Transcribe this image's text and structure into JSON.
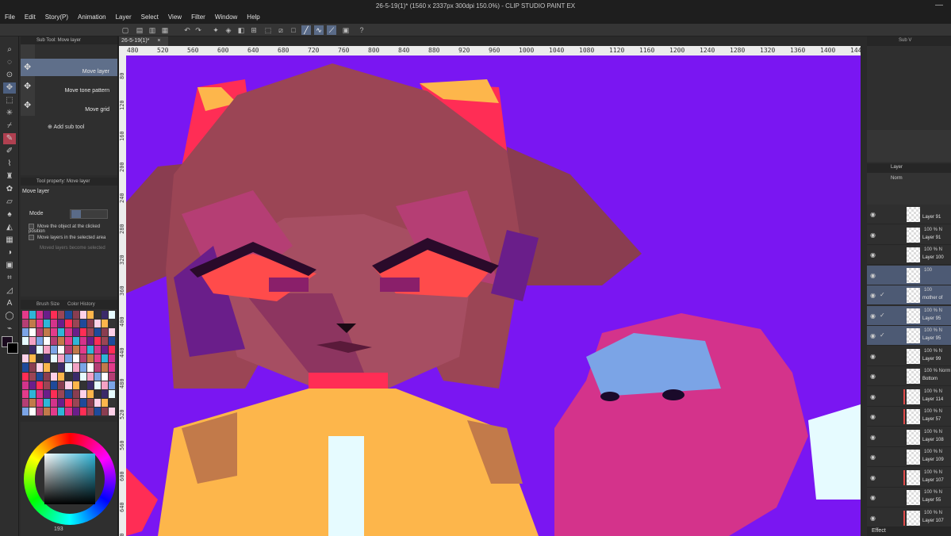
{
  "window": {
    "title": "26-5-19(1)* (1560 x 2337px 300dpi 150.0%)  - CLIP STUDIO PAINT EX",
    "minimize": "—"
  },
  "menu": [
    "File",
    "Edit",
    "Story(P)",
    "Animation",
    "Layer",
    "Select",
    "View",
    "Filter",
    "Window",
    "Help"
  ],
  "subtool": {
    "title": "Sub Tool: Move layer",
    "items": [
      "Move layer",
      "Move tone pattern",
      "Move grid"
    ],
    "add_label": "Add sub tool"
  },
  "tool_property": {
    "title": "Tool property: Move layer",
    "heading": "Move layer",
    "mode_label": "Mode",
    "options": [
      "Move the object at the clicked position",
      "Move layers in the selected area",
      "Moved layers become selected"
    ]
  },
  "color_tabs": [
    "Brush Size",
    "Color History"
  ],
  "color_wheel": {
    "value_label": "193"
  },
  "document": {
    "tab_label": "26-5-19(1)*",
    "ruler_h": [
      "480",
      "520",
      "560",
      "600",
      "640",
      "680",
      "720",
      "760",
      "800",
      "840",
      "880",
      "920",
      "960",
      "1000",
      "1040",
      "1080",
      "1120",
      "1160",
      "1200",
      "1240",
      "1280",
      "1320",
      "1360",
      "1400",
      "1440"
    ],
    "ruler_v": [
      "80",
      "120",
      "160",
      "200",
      "240",
      "280",
      "320",
      "360",
      "400",
      "440",
      "480",
      "520",
      "560",
      "600",
      "640",
      "680"
    ]
  },
  "right_panel": {
    "tab": "Sub V",
    "layer_tab": "Layer",
    "blend": "Norm",
    "effect": "Effect",
    "layers": [
      {
        "pct": "",
        "name": "Layer 91",
        "sel": false,
        "red": false,
        "check": false
      },
      {
        "pct": "100 % N",
        "name": "Layer 91",
        "sel": false,
        "red": false,
        "check": false
      },
      {
        "pct": "100 % N",
        "name": "Layer 100",
        "sel": false,
        "red": false,
        "check": false
      },
      {
        "pct": "100",
        "name": "",
        "sel": true,
        "red": false,
        "check": false
      },
      {
        "pct": "100",
        "name": "mother of",
        "sel": true,
        "red": false,
        "check": true
      },
      {
        "pct": "100 % N",
        "name": "Layer 95",
        "sel": true,
        "red": false,
        "check": true
      },
      {
        "pct": "100 % N",
        "name": "Layer 95",
        "sel": true,
        "red": false,
        "check": true
      },
      {
        "pct": "100 % N",
        "name": "Layer 99",
        "sel": false,
        "red": false,
        "check": false
      },
      {
        "pct": "100 % Norm",
        "name": "Bottom",
        "sel": false,
        "red": false,
        "check": false
      },
      {
        "pct": "100 % N",
        "name": "Layer 114",
        "sel": false,
        "red": true,
        "check": false
      },
      {
        "pct": "100 % N",
        "name": "Layer 57",
        "sel": false,
        "red": true,
        "check": false
      },
      {
        "pct": "100 % N",
        "name": "Layer 108",
        "sel": false,
        "red": false,
        "check": false
      },
      {
        "pct": "100 % N",
        "name": "Layer 109",
        "sel": false,
        "red": false,
        "check": false
      },
      {
        "pct": "100 % N",
        "name": "Layer 107",
        "sel": false,
        "red": true,
        "check": false
      },
      {
        "pct": "100 % N",
        "name": "Layer 55",
        "sel": false,
        "red": false,
        "check": false
      },
      {
        "pct": "100 % N",
        "name": "Layer 107",
        "sel": false,
        "red": true,
        "check": false
      }
    ]
  },
  "colors": {
    "canvas_bg": "#7a16f2",
    "hair": "#9b4555",
    "shirt": "#fdb64b",
    "pink_creature": "#d4338b",
    "accent_red": "#ff2d55"
  }
}
